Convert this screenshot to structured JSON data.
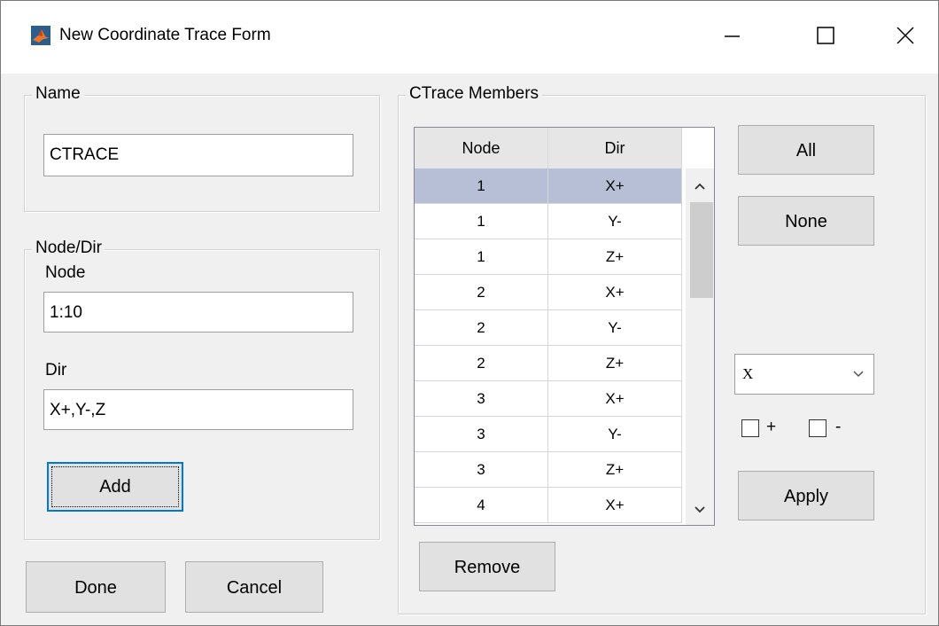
{
  "window": {
    "title": "New Coordinate Trace Form"
  },
  "name_group": {
    "legend": "Name",
    "value": "CTRACE"
  },
  "nodedir_group": {
    "legend": "Node/Dir",
    "node_label": "Node",
    "node_value": "1:10",
    "dir_label": "Dir",
    "dir_value": "X+,Y-,Z",
    "add_label": "Add"
  },
  "footer": {
    "done_label": "Done",
    "cancel_label": "Cancel"
  },
  "ctrace_group": {
    "legend": "CTrace Members",
    "columns": [
      "Node",
      "Dir"
    ],
    "rows": [
      [
        "1",
        "X+"
      ],
      [
        "1",
        "Y-"
      ],
      [
        "1",
        "Z+"
      ],
      [
        "2",
        "X+"
      ],
      [
        "2",
        "Y-"
      ],
      [
        "2",
        "Z+"
      ],
      [
        "3",
        "X+"
      ],
      [
        "3",
        "Y-"
      ],
      [
        "3",
        "Z+"
      ],
      [
        "4",
        "X+"
      ]
    ],
    "selected_row": 0,
    "remove_label": "Remove",
    "all_label": "All",
    "none_label": "None",
    "axis_select": "X",
    "plus_label": "+",
    "minus_label": "-",
    "apply_label": "Apply"
  },
  "colors": {
    "selection": "#b6bfd6",
    "accent": "#0078d7"
  },
  "icons": {
    "app": "matlab-icon",
    "minimize": "minimize-icon",
    "maximize": "maximize-icon",
    "close": "close-icon",
    "scroll_up": "chevron-up-icon",
    "scroll_down": "chevron-down-icon",
    "dropdown": "chevron-down-icon"
  }
}
